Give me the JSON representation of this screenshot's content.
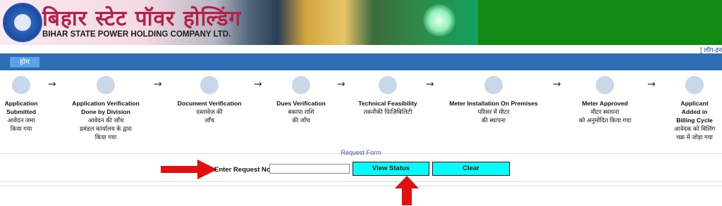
{
  "header": {
    "title_hindi": "बिहार स्टेट पॉवर होल्डिंग",
    "title_english": "BIHAR STATE POWER HOLDING COMPANY LTD.",
    "banner_color": "#138a13"
  },
  "top_link": {
    "label": "[ लॉग-इन"
  },
  "nav": {
    "home_label": "होम",
    "bar_color": "#2e6db5"
  },
  "steps": [
    {
      "en": [
        "Application",
        "Submitted"
      ],
      "hi": [
        "आवेदन जमा",
        "किया गया"
      ]
    },
    {
      "en": [
        "Application Verification",
        "Done by Division"
      ],
      "hi": [
        "आवेदन की जाँच",
        "प्रमंडल कार्यालय के द्वारा",
        "किया गया"
      ]
    },
    {
      "en": [
        "Document Verification"
      ],
      "hi": [
        "दस्तावेज़ की",
        "जाँच"
      ]
    },
    {
      "en": [
        "Dues Verification"
      ],
      "hi": [
        "बकाया राशि",
        "की जाँच"
      ]
    },
    {
      "en": [
        "Technical Feasibility"
      ],
      "hi": [
        "तकनीकी फ़िज़िबिलिटी"
      ]
    },
    {
      "en": [
        "Meter Installation On Premises"
      ],
      "hi": [
        "परिसर में मीटर",
        "की स्थापना"
      ]
    },
    {
      "en": [
        "Meter Approved"
      ],
      "hi": [
        "मीटर स्थापना",
        "को अनुमोदित किया गया"
      ]
    },
    {
      "en": [
        "Applicant",
        "Added in",
        "Billing Cycle"
      ],
      "hi": [
        "आवेदक को बिलिंग",
        "चक्र में जोड़ा गया"
      ]
    }
  ],
  "form": {
    "title": "Request Form",
    "label": "Enter Request No:",
    "input_value": "",
    "view_button": "View Status",
    "clear_button": "Clear"
  },
  "colors": {
    "button": "#00ffff",
    "step_circle": "#c9d8e9",
    "annotation_arrow": "#e01010"
  }
}
